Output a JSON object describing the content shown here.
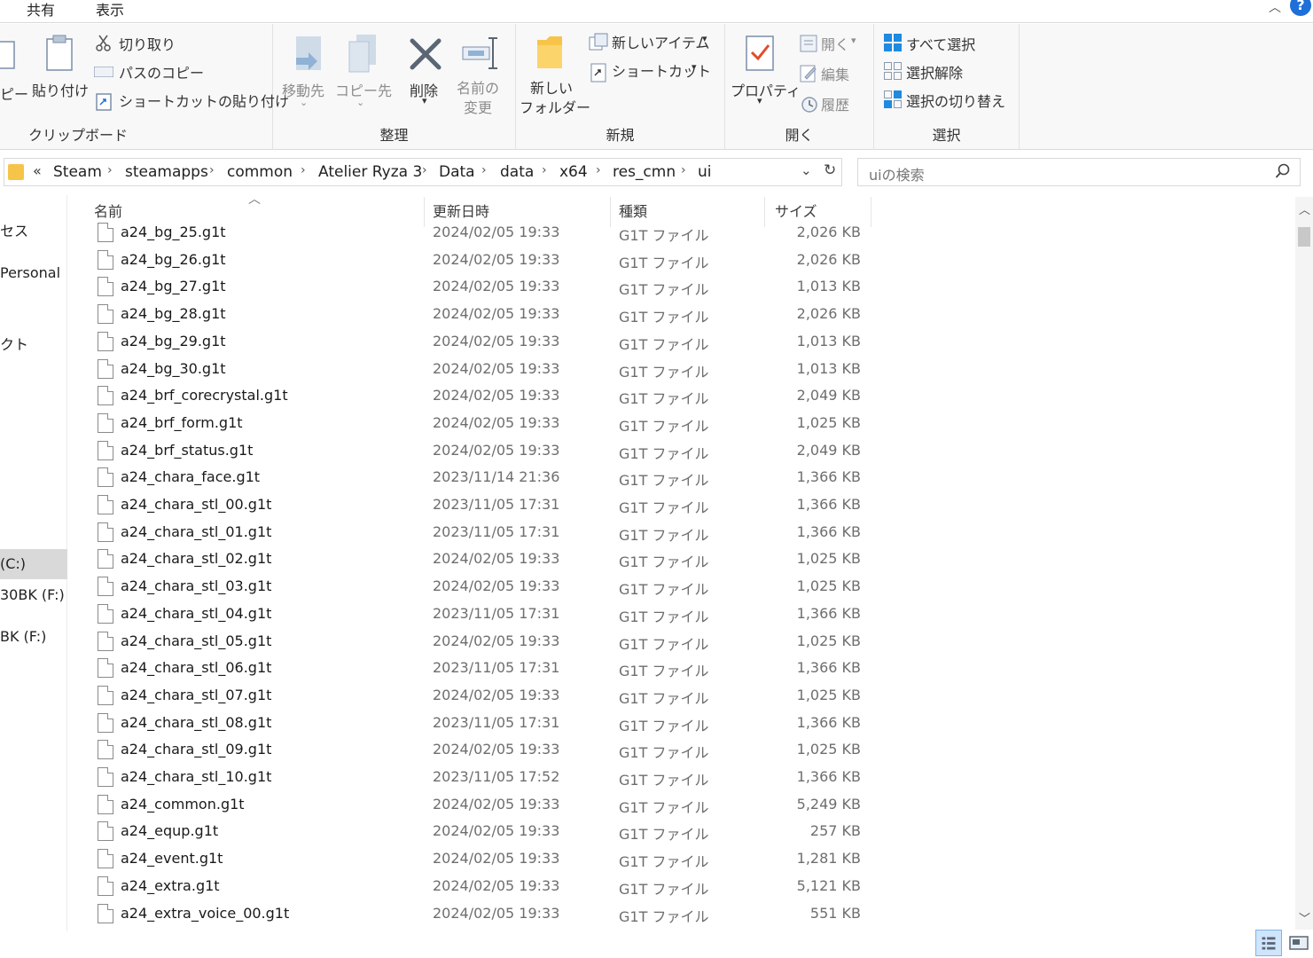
{
  "tabs": {
    "share": "共有",
    "view": "表示"
  },
  "ribbon": {
    "clipboard": {
      "label": "クリップボード",
      "copy": "ピー",
      "paste": "貼り付け",
      "cut": "切り取り",
      "copy_path": "パスのコピー",
      "paste_shortcut": "ショートカットの貼り付け"
    },
    "organize": {
      "label": "整理",
      "move_to": "移動先",
      "copy_to": "コピー先",
      "delete": "削除",
      "rename_1": "名前の",
      "rename_2": "変更"
    },
    "new": {
      "label": "新規",
      "new_folder_1": "新しい",
      "new_folder_2": "フォルダー",
      "new_item": "新しいアイテム",
      "shortcut": "ショートカット"
    },
    "open": {
      "label": "開く",
      "properties": "プロパティ",
      "open": "開く",
      "edit": "編集",
      "history": "履歴"
    },
    "select": {
      "label": "選択",
      "select_all": "すべて選択",
      "select_none": "選択解除",
      "invert": "選択の切り替え"
    }
  },
  "address": {
    "overflow": "«",
    "crumbs": [
      "Steam",
      "steamapps",
      "common",
      "Atelier Ryza 3",
      "Data",
      "data",
      "x64",
      "res_cmn",
      "ui"
    ],
    "separator": "›"
  },
  "search": {
    "placeholder": "uiの検索"
  },
  "nav": {
    "items": [
      {
        "label": "セス",
        "selected": false
      },
      {
        "label": "Personal",
        "selected": false
      },
      {
        "label": "クト",
        "selected": false
      },
      {
        "label": "(C:)",
        "selected": true
      },
      {
        "label": "30BK (F:)",
        "selected": false
      },
      {
        "label": "BK (F:)",
        "selected": false
      }
    ]
  },
  "columns": {
    "name": "名前",
    "date": "更新日時",
    "type": "種類",
    "size": "サイズ"
  },
  "files": [
    {
      "name": "a24_bg_25.g1t",
      "date": "2024/02/05 19:33",
      "type": "G1T ファイル",
      "size": "2,026 KB"
    },
    {
      "name": "a24_bg_26.g1t",
      "date": "2024/02/05 19:33",
      "type": "G1T ファイル",
      "size": "2,026 KB"
    },
    {
      "name": "a24_bg_27.g1t",
      "date": "2024/02/05 19:33",
      "type": "G1T ファイル",
      "size": "1,013 KB"
    },
    {
      "name": "a24_bg_28.g1t",
      "date": "2024/02/05 19:33",
      "type": "G1T ファイル",
      "size": "2,026 KB"
    },
    {
      "name": "a24_bg_29.g1t",
      "date": "2024/02/05 19:33",
      "type": "G1T ファイル",
      "size": "1,013 KB"
    },
    {
      "name": "a24_bg_30.g1t",
      "date": "2024/02/05 19:33",
      "type": "G1T ファイル",
      "size": "1,013 KB"
    },
    {
      "name": "a24_brf_corecrystal.g1t",
      "date": "2024/02/05 19:33",
      "type": "G1T ファイル",
      "size": "2,049 KB"
    },
    {
      "name": "a24_brf_form.g1t",
      "date": "2024/02/05 19:33",
      "type": "G1T ファイル",
      "size": "1,025 KB"
    },
    {
      "name": "a24_brf_status.g1t",
      "date": "2024/02/05 19:33",
      "type": "G1T ファイル",
      "size": "2,049 KB"
    },
    {
      "name": "a24_chara_face.g1t",
      "date": "2023/11/14 21:36",
      "type": "G1T ファイル",
      "size": "1,366 KB"
    },
    {
      "name": "a24_chara_stl_00.g1t",
      "date": "2023/11/05 17:31",
      "type": "G1T ファイル",
      "size": "1,366 KB"
    },
    {
      "name": "a24_chara_stl_01.g1t",
      "date": "2023/11/05 17:31",
      "type": "G1T ファイル",
      "size": "1,366 KB"
    },
    {
      "name": "a24_chara_stl_02.g1t",
      "date": "2024/02/05 19:33",
      "type": "G1T ファイル",
      "size": "1,025 KB"
    },
    {
      "name": "a24_chara_stl_03.g1t",
      "date": "2024/02/05 19:33",
      "type": "G1T ファイル",
      "size": "1,025 KB"
    },
    {
      "name": "a24_chara_stl_04.g1t",
      "date": "2023/11/05 17:31",
      "type": "G1T ファイル",
      "size": "1,366 KB"
    },
    {
      "name": "a24_chara_stl_05.g1t",
      "date": "2024/02/05 19:33",
      "type": "G1T ファイル",
      "size": "1,025 KB"
    },
    {
      "name": "a24_chara_stl_06.g1t",
      "date": "2023/11/05 17:31",
      "type": "G1T ファイル",
      "size": "1,366 KB"
    },
    {
      "name": "a24_chara_stl_07.g1t",
      "date": "2024/02/05 19:33",
      "type": "G1T ファイル",
      "size": "1,025 KB"
    },
    {
      "name": "a24_chara_stl_08.g1t",
      "date": "2023/11/05 17:31",
      "type": "G1T ファイル",
      "size": "1,366 KB"
    },
    {
      "name": "a24_chara_stl_09.g1t",
      "date": "2024/02/05 19:33",
      "type": "G1T ファイル",
      "size": "1,025 KB"
    },
    {
      "name": "a24_chara_stl_10.g1t",
      "date": "2023/11/05 17:52",
      "type": "G1T ファイル",
      "size": "1,366 KB"
    },
    {
      "name": "a24_common.g1t",
      "date": "2024/02/05 19:33",
      "type": "G1T ファイル",
      "size": "5,249 KB"
    },
    {
      "name": "a24_equp.g1t",
      "date": "2024/02/05 19:33",
      "type": "G1T ファイル",
      "size": "257 KB"
    },
    {
      "name": "a24_event.g1t",
      "date": "2024/02/05 19:33",
      "type": "G1T ファイル",
      "size": "1,281 KB"
    },
    {
      "name": "a24_extra.g1t",
      "date": "2024/02/05 19:33",
      "type": "G1T ファイル",
      "size": "5,121 KB"
    },
    {
      "name": "a24_extra_voice_00.g1t",
      "date": "2024/02/05 19:33",
      "type": "G1T ファイル",
      "size": "551 KB"
    }
  ],
  "colors": {
    "accent": "#1e6fd8",
    "selected_nav": "#d9d9d9",
    "folder": "#f7c44a"
  }
}
